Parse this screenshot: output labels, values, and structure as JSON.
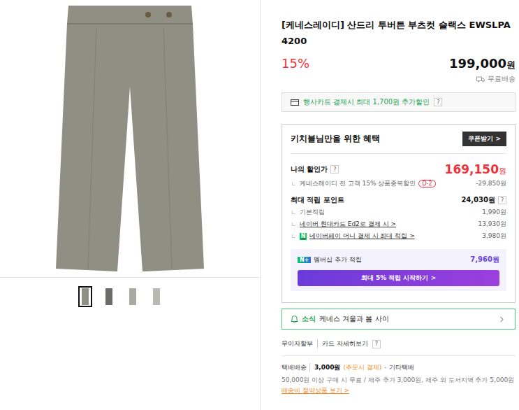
{
  "thumbnails": [
    {
      "selected": true,
      "color": "#8f8f84"
    },
    {
      "selected": false,
      "color": "#6b6b68"
    },
    {
      "selected": false,
      "color": "#a9a99f"
    },
    {
      "selected": false,
      "color": "#b8b9b0"
    }
  ],
  "title": "[케네스레이디] 산드리 투버튼 부츠컷 슬랙스 EWSLPA4200",
  "discount_rate": "15%",
  "price": "199,000",
  "price_unit": "원",
  "shipping_badge": "무료배송",
  "card_promo": {
    "text": "행사카드 결제시 최대 1,700원 추가할인",
    "help": "?"
  },
  "benefits": {
    "title": "키치블님만을 위한 혜택",
    "coupon_button": "쿠폰받기 >",
    "my_price": {
      "label": "나의 할인가",
      "help": "?",
      "value": "169,150",
      "unit": "원",
      "details": [
        {
          "label": "케네스레이디 전 고객 15% 상품중복할인",
          "badge": "D-2",
          "value": "-29,850원"
        }
      ]
    },
    "points": {
      "label": "최대 적립 포인트",
      "value": "24,030원",
      "help": "?",
      "details": [
        {
          "kind": "plain",
          "label": "기본적립",
          "value": "1,990원",
          "logo": ""
        },
        {
          "kind": "link",
          "label": "네이버 현대카드 Ed2로 결제 시 >",
          "value": "13,930원",
          "logo": ""
        },
        {
          "kind": "pay",
          "label": "네이버페이 머니 결제 시 최대 적립 >",
          "value": "3,980원",
          "logo": "N"
        }
      ]
    },
    "membership": {
      "logo": "N+",
      "label": "멤버십 추가 적립",
      "value": "7,960원",
      "button": "최대 5% 적립 시작하기 >"
    }
  },
  "news": {
    "tag": "소식",
    "text": "케네스 겨울과 봄 사이"
  },
  "installment": {
    "items": [
      "무이자할부",
      "카드 자세히보기"
    ],
    "help": "?"
  },
  "delivery": {
    "method": "택배배송",
    "fee": "3,000원",
    "fee_note": "(주문시 결제)",
    "separator": "·",
    "courier": "기타택배",
    "note": "50,000원 이상 구매 시 무료 / 제주 추가 3,000원, 제주 외 도서지역 추가 5,000원",
    "link": "배송비 절약상품 보기 >"
  }
}
